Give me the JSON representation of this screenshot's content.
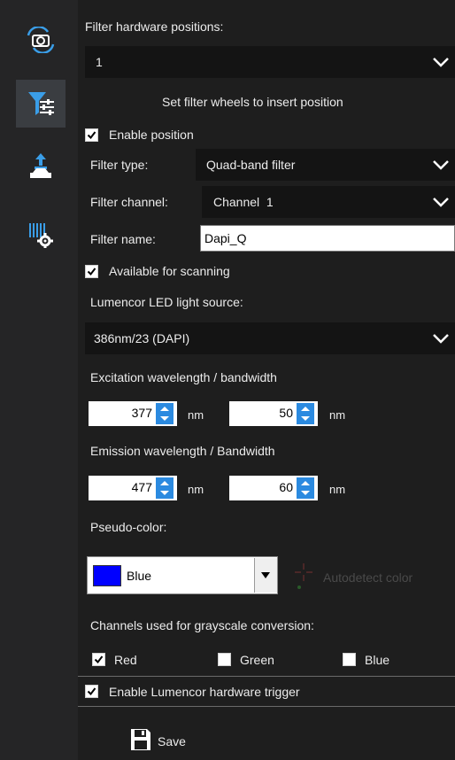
{
  "filter_positions": {
    "label": "Filter hardware positions:",
    "selected": "1"
  },
  "section_title": "Set filter wheels to insert position",
  "enable_position": {
    "label": "Enable position",
    "checked": true
  },
  "filter_type": {
    "label": "Filter type:",
    "value": "Quad-band filter"
  },
  "filter_channel": {
    "label": "Filter channel:",
    "value": "Channel  1"
  },
  "filter_name": {
    "label": "Filter name:",
    "value": "Dapi_Q"
  },
  "available_scanning": {
    "label": "Available for scanning",
    "checked": true
  },
  "light_source": {
    "label": "Lumencor LED light source:",
    "value": "386nm/23 (DAPI)"
  },
  "excitation": {
    "label": "Excitation wavelength / bandwidth",
    "wavelength": "377",
    "bandwidth": "50",
    "unit": "nm"
  },
  "emission": {
    "label": "Emission wavelength / Bandwidth",
    "wavelength": "477",
    "bandwidth": "60",
    "unit": "nm"
  },
  "pseudo_color": {
    "label": "Pseudo-color:",
    "value": "Blue",
    "swatch": "#0000ff",
    "autodetect_label": "Autodetect color"
  },
  "grayscale": {
    "label": "Channels used for grayscale conversion:",
    "red": {
      "label": "Red",
      "checked": true
    },
    "green": {
      "label": "Green",
      "checked": false
    },
    "blue": {
      "label": "Blue",
      "checked": false
    }
  },
  "hardware_trigger": {
    "label": "Enable Lumencor hardware trigger",
    "checked": true
  },
  "save_label": "Save",
  "sidebar": [
    "camera-settings-icon",
    "filter-settings-icon",
    "stage-settings-icon",
    "barcode-settings-icon"
  ],
  "colors": {
    "accent": "#2b8ae0",
    "sidebar_icon_blue": "#3a9ee8"
  }
}
